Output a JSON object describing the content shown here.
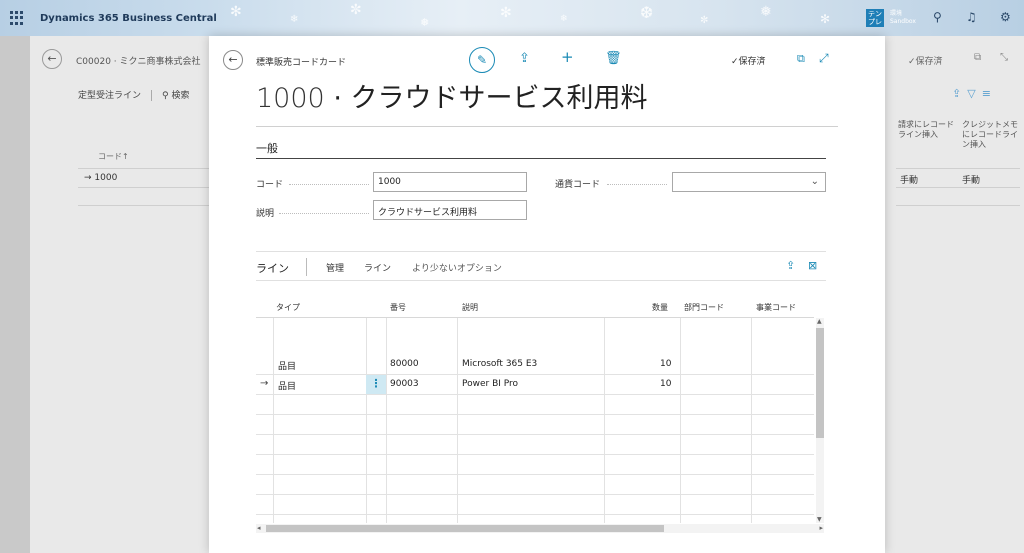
{
  "topbar": {
    "brand": "Dynamics 365 Business Central",
    "env_badge": "テン\nプレ",
    "env_label": "環境",
    "env_name": "Sandbox"
  },
  "background_page": {
    "title": "C00020 · ミクニ商事株式会社",
    "actions": [
      "定型受注ライン",
      "検索"
    ],
    "saved": "保存済",
    "col_code": "コード↑",
    "row_code": "1000",
    "col_invoice": "請求にレコードライン挿入",
    "col_credit": "クレジットメモにレコードライン挿入",
    "invoice_value": "手動",
    "credit_value": "手動"
  },
  "modal": {
    "caption": "標準販売コードカード",
    "saved": "保存済",
    "title_number": "1000",
    "title_sep": "·",
    "title_name": "クラウドサービス利用料",
    "section": "一般",
    "fields": {
      "code_label": "コード",
      "code_value": "1000",
      "desc_label": "説明",
      "desc_value": "クラウドサービス利用料",
      "currency_label": "通貨コード",
      "currency_value": ""
    },
    "lines": {
      "title": "ライン",
      "actions": [
        "管理",
        "ライン",
        "より少ないオプション"
      ],
      "columns": [
        "タイプ",
        "番号",
        "説明",
        "数量",
        "部門コード",
        "事業コード"
      ],
      "rows": [
        {
          "type": "品目",
          "no": "80000",
          "desc": "Microsoft 365 E3",
          "qty": "10",
          "current": false
        },
        {
          "type": "品目",
          "no": "90003",
          "desc": "Power BI Pro",
          "qty": "10",
          "current": true
        }
      ]
    }
  }
}
